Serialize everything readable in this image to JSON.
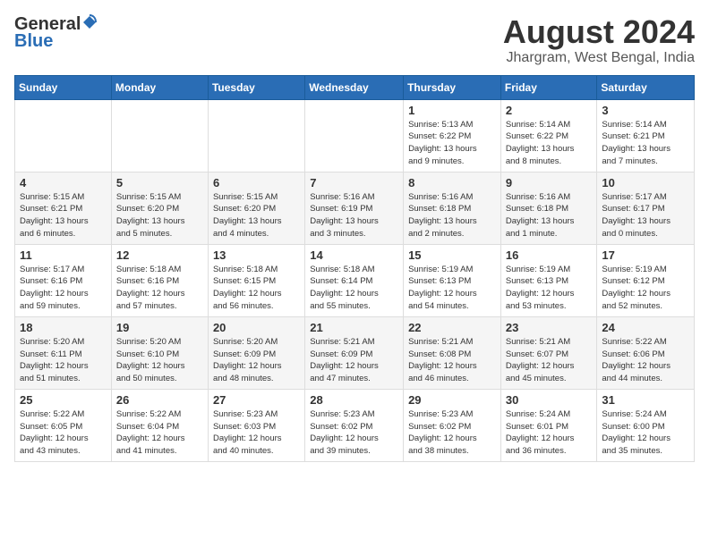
{
  "header": {
    "logo_general": "General",
    "logo_blue": "Blue",
    "title": "August 2024",
    "subtitle": "Jhargram, West Bengal, India"
  },
  "weekdays": [
    "Sunday",
    "Monday",
    "Tuesday",
    "Wednesday",
    "Thursday",
    "Friday",
    "Saturday"
  ],
  "weeks": [
    [
      {
        "day": "",
        "info": ""
      },
      {
        "day": "",
        "info": ""
      },
      {
        "day": "",
        "info": ""
      },
      {
        "day": "",
        "info": ""
      },
      {
        "day": "1",
        "info": "Sunrise: 5:13 AM\nSunset: 6:22 PM\nDaylight: 13 hours\nand 9 minutes."
      },
      {
        "day": "2",
        "info": "Sunrise: 5:14 AM\nSunset: 6:22 PM\nDaylight: 13 hours\nand 8 minutes."
      },
      {
        "day": "3",
        "info": "Sunrise: 5:14 AM\nSunset: 6:21 PM\nDaylight: 13 hours\nand 7 minutes."
      }
    ],
    [
      {
        "day": "4",
        "info": "Sunrise: 5:15 AM\nSunset: 6:21 PM\nDaylight: 13 hours\nand 6 minutes."
      },
      {
        "day": "5",
        "info": "Sunrise: 5:15 AM\nSunset: 6:20 PM\nDaylight: 13 hours\nand 5 minutes."
      },
      {
        "day": "6",
        "info": "Sunrise: 5:15 AM\nSunset: 6:20 PM\nDaylight: 13 hours\nand 4 minutes."
      },
      {
        "day": "7",
        "info": "Sunrise: 5:16 AM\nSunset: 6:19 PM\nDaylight: 13 hours\nand 3 minutes."
      },
      {
        "day": "8",
        "info": "Sunrise: 5:16 AM\nSunset: 6:18 PM\nDaylight: 13 hours\nand 2 minutes."
      },
      {
        "day": "9",
        "info": "Sunrise: 5:16 AM\nSunset: 6:18 PM\nDaylight: 13 hours\nand 1 minute."
      },
      {
        "day": "10",
        "info": "Sunrise: 5:17 AM\nSunset: 6:17 PM\nDaylight: 13 hours\nand 0 minutes."
      }
    ],
    [
      {
        "day": "11",
        "info": "Sunrise: 5:17 AM\nSunset: 6:16 PM\nDaylight: 12 hours\nand 59 minutes."
      },
      {
        "day": "12",
        "info": "Sunrise: 5:18 AM\nSunset: 6:16 PM\nDaylight: 12 hours\nand 57 minutes."
      },
      {
        "day": "13",
        "info": "Sunrise: 5:18 AM\nSunset: 6:15 PM\nDaylight: 12 hours\nand 56 minutes."
      },
      {
        "day": "14",
        "info": "Sunrise: 5:18 AM\nSunset: 6:14 PM\nDaylight: 12 hours\nand 55 minutes."
      },
      {
        "day": "15",
        "info": "Sunrise: 5:19 AM\nSunset: 6:13 PM\nDaylight: 12 hours\nand 54 minutes."
      },
      {
        "day": "16",
        "info": "Sunrise: 5:19 AM\nSunset: 6:13 PM\nDaylight: 12 hours\nand 53 minutes."
      },
      {
        "day": "17",
        "info": "Sunrise: 5:19 AM\nSunset: 6:12 PM\nDaylight: 12 hours\nand 52 minutes."
      }
    ],
    [
      {
        "day": "18",
        "info": "Sunrise: 5:20 AM\nSunset: 6:11 PM\nDaylight: 12 hours\nand 51 minutes."
      },
      {
        "day": "19",
        "info": "Sunrise: 5:20 AM\nSunset: 6:10 PM\nDaylight: 12 hours\nand 50 minutes."
      },
      {
        "day": "20",
        "info": "Sunrise: 5:20 AM\nSunset: 6:09 PM\nDaylight: 12 hours\nand 48 minutes."
      },
      {
        "day": "21",
        "info": "Sunrise: 5:21 AM\nSunset: 6:09 PM\nDaylight: 12 hours\nand 47 minutes."
      },
      {
        "day": "22",
        "info": "Sunrise: 5:21 AM\nSunset: 6:08 PM\nDaylight: 12 hours\nand 46 minutes."
      },
      {
        "day": "23",
        "info": "Sunrise: 5:21 AM\nSunset: 6:07 PM\nDaylight: 12 hours\nand 45 minutes."
      },
      {
        "day": "24",
        "info": "Sunrise: 5:22 AM\nSunset: 6:06 PM\nDaylight: 12 hours\nand 44 minutes."
      }
    ],
    [
      {
        "day": "25",
        "info": "Sunrise: 5:22 AM\nSunset: 6:05 PM\nDaylight: 12 hours\nand 43 minutes."
      },
      {
        "day": "26",
        "info": "Sunrise: 5:22 AM\nSunset: 6:04 PM\nDaylight: 12 hours\nand 41 minutes."
      },
      {
        "day": "27",
        "info": "Sunrise: 5:23 AM\nSunset: 6:03 PM\nDaylight: 12 hours\nand 40 minutes."
      },
      {
        "day": "28",
        "info": "Sunrise: 5:23 AM\nSunset: 6:02 PM\nDaylight: 12 hours\nand 39 minutes."
      },
      {
        "day": "29",
        "info": "Sunrise: 5:23 AM\nSunset: 6:02 PM\nDaylight: 12 hours\nand 38 minutes."
      },
      {
        "day": "30",
        "info": "Sunrise: 5:24 AM\nSunset: 6:01 PM\nDaylight: 12 hours\nand 36 minutes."
      },
      {
        "day": "31",
        "info": "Sunrise: 5:24 AM\nSunset: 6:00 PM\nDaylight: 12 hours\nand 35 minutes."
      }
    ]
  ]
}
